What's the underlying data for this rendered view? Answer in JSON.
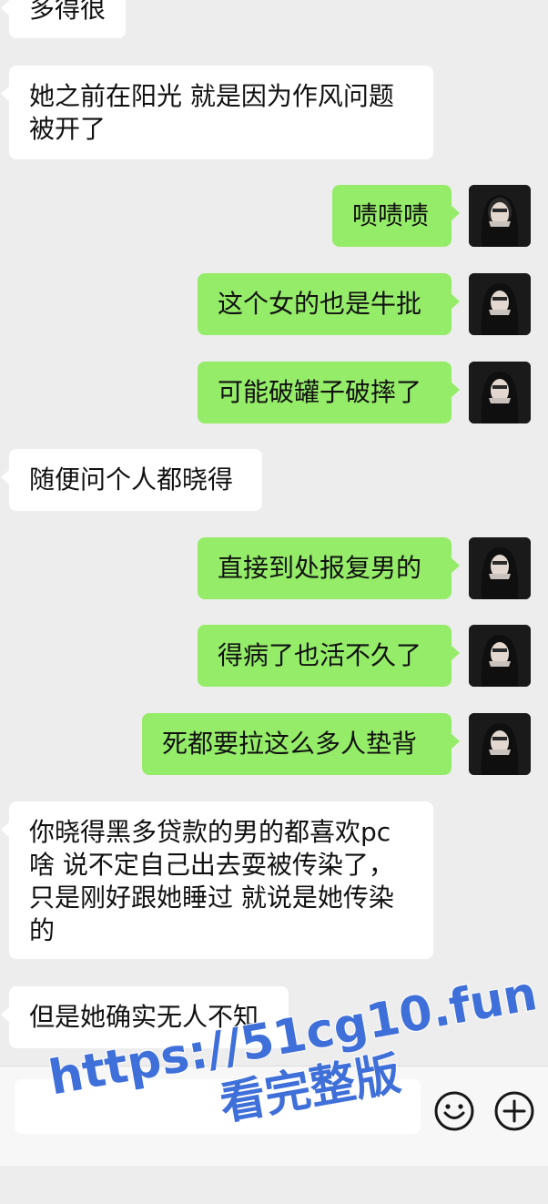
{
  "colors": {
    "background": "#ededed",
    "incoming_bubble": "#ffffff",
    "outgoing_bubble": "#95ec69",
    "watermark": "#3f6fd8"
  },
  "messages": [
    {
      "side": "incoming",
      "text": "多得很"
    },
    {
      "side": "incoming",
      "text": "她之前在阳光 就是因为作风问题\n被开了"
    },
    {
      "side": "outgoing",
      "text": "啧啧啧"
    },
    {
      "side": "outgoing",
      "text": "这个女的也是牛批"
    },
    {
      "side": "outgoing",
      "text": "可能破罐子破摔了"
    },
    {
      "side": "incoming",
      "text": "随便问个人都晓得"
    },
    {
      "side": "outgoing",
      "text": "直接到处报复男的"
    },
    {
      "side": "outgoing",
      "text": "得病了也活不久了"
    },
    {
      "side": "outgoing",
      "text": "死都要拉这么多人垫背"
    },
    {
      "side": "incoming",
      "text": "你晓得黑多贷款的男的都喜欢pc\n啥 说不定自己出去耍被传染了，\n只是刚好跟她睡过 就说是她传染\n的"
    },
    {
      "side": "incoming",
      "text": "但是她确实无人不知"
    }
  ],
  "input_bar": {
    "emoji_icon": "smiley-face-icon",
    "plus_icon": "plus-circle-icon"
  },
  "watermark": {
    "line1": "https://51cg10.fun",
    "line2": "看完整版"
  }
}
